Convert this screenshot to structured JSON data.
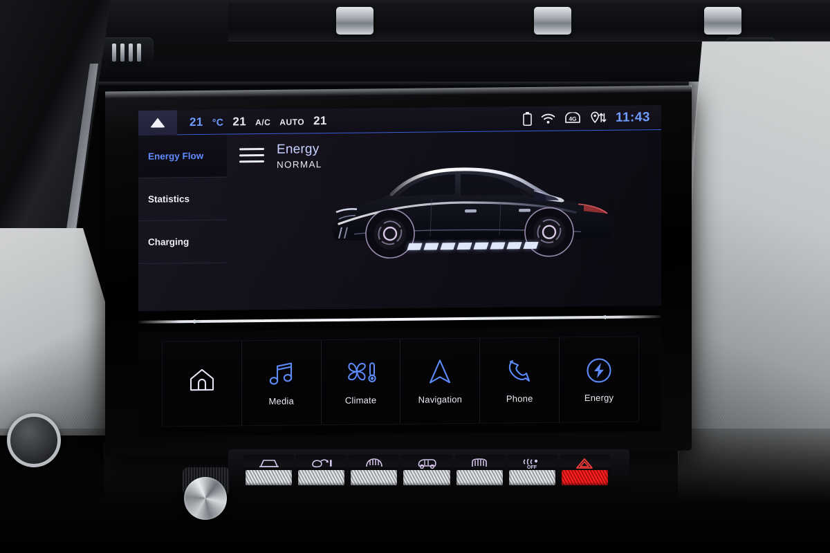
{
  "screen": {
    "status_bar": {
      "pull_icon": "triangle-up-icon",
      "climate": {
        "temp_left": "21",
        "temp_left_unit": "°C",
        "fan_level": "21",
        "ac_label": "A/C",
        "auto_label": "AUTO",
        "temp_right": "21"
      },
      "icons": [
        "battery-icon",
        "wifi-icon",
        "4g-icon",
        "location-share-icon"
      ],
      "network_label": "4G",
      "time": "11:43"
    },
    "side_menu": {
      "items": [
        {
          "label": "Energy Flow",
          "active": true
        },
        {
          "label": "Statistics",
          "active": false
        },
        {
          "label": "Charging",
          "active": false
        }
      ]
    },
    "menu_button": "hamburger-menu-icon",
    "header": {
      "title": "Energy",
      "subtitle": "NORMAL"
    },
    "energy_flow": {
      "vehicle": "car-side-profile-illustration",
      "segment_count": 8,
      "segment_color": "#dfe7fb"
    }
  },
  "touch_bar": {
    "items": [
      {
        "label": "",
        "icon": "home-icon",
        "accent": "#e4e2f2"
      },
      {
        "label": "Media",
        "icon": "music-note-icon",
        "accent": "#5d8bfb"
      },
      {
        "label": "Climate",
        "icon": "fan-thermometer-icon",
        "accent": "#5d8bfb"
      },
      {
        "label": "Navigation",
        "icon": "navigation-arrow-icon",
        "accent": "#5d8bfb"
      },
      {
        "label": "Phone",
        "icon": "phone-handset-icon",
        "accent": "#5d8bfb"
      },
      {
        "label": "Energy",
        "icon": "energy-bolt-circle-icon",
        "accent": "#5d8bfb"
      }
    ]
  },
  "physical_controls": {
    "knob": "volume-knob",
    "buttons": [
      {
        "icon": "front-demist-icon",
        "hazard": false
      },
      {
        "icon": "air-recirculation-icon",
        "hazard": false
      },
      {
        "icon": "windscreen-defrost-icon",
        "hazard": false
      },
      {
        "icon": "rear-window-defrost-icon",
        "hazard": false
      },
      {
        "icon": "rear-demist-icon",
        "hazard": false
      },
      {
        "icon": "auto-off-icon",
        "hazard": false
      },
      {
        "icon": "hazard-warning-icon",
        "hazard": true
      }
    ]
  },
  "colors": {
    "accent_blue": "#5d8bfb",
    "time_blue": "#6f9dff",
    "text_white": "#e9eaf2",
    "hazard_red": "#ff2222"
  }
}
